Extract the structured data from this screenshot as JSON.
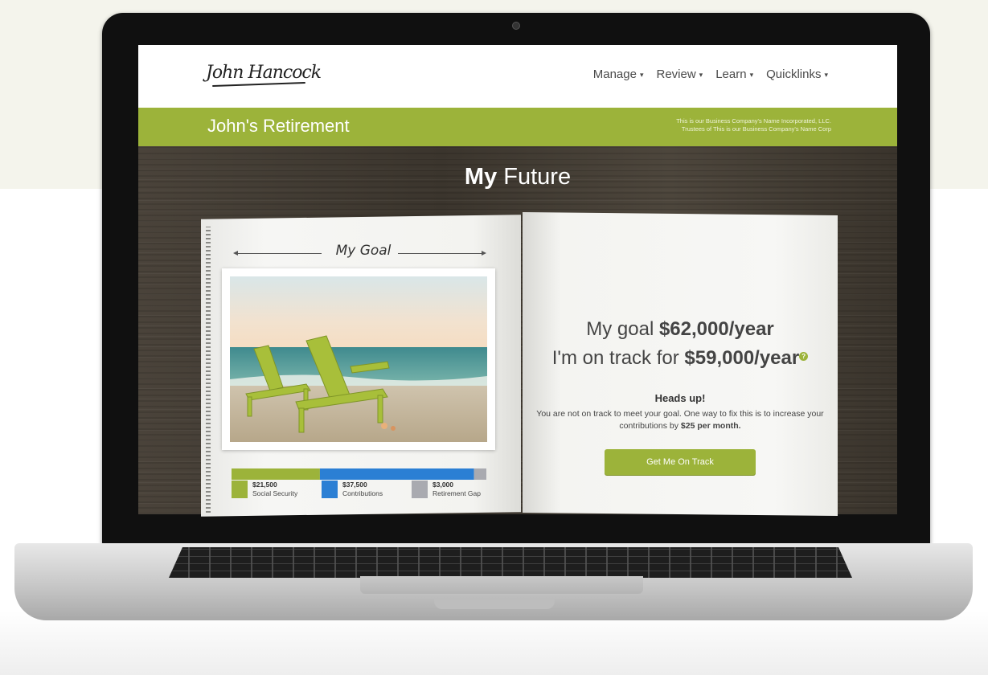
{
  "header": {
    "logo_text": "John Hancock",
    "nav": [
      "Manage",
      "Review",
      "Learn",
      "Quicklinks"
    ],
    "caret": "▾"
  },
  "account": {
    "title": "John's Retirement",
    "company_line1": "This is our Business Company's Name Incorporated, LLC.",
    "company_line2": "Trustees of This is our Business Company's Name Corp"
  },
  "page": {
    "heading_bold": "My",
    "heading_rest": "Future"
  },
  "goal_page": {
    "label": "My Goal",
    "breakdown": [
      {
        "value": "$21,500",
        "label": "Social Security",
        "amount": 21500,
        "color": "#9cb33a"
      },
      {
        "value": "$37,500",
        "label": "Contributions",
        "amount": 37500,
        "color": "#2b7fd4"
      },
      {
        "value": "$3,000",
        "label": "Retirement Gap",
        "amount": 3000,
        "color": "#a9aab0"
      }
    ]
  },
  "summary": {
    "goal_prefix": "My goal",
    "goal_value": "$62,000/year",
    "track_prefix": "I'm on track for",
    "track_value": "$59,000/year",
    "help_icon": "?",
    "heads_up": "Heads up!",
    "message": "You are not on track to meet your goal. One way to fix this is to increase your contributions by",
    "message_bold": "$25 per month.",
    "cta": "Get Me On Track"
  },
  "colors": {
    "brand_green": "#9cb33a",
    "contribution_blue": "#2b7fd4",
    "gap_gray": "#a9aab0"
  }
}
